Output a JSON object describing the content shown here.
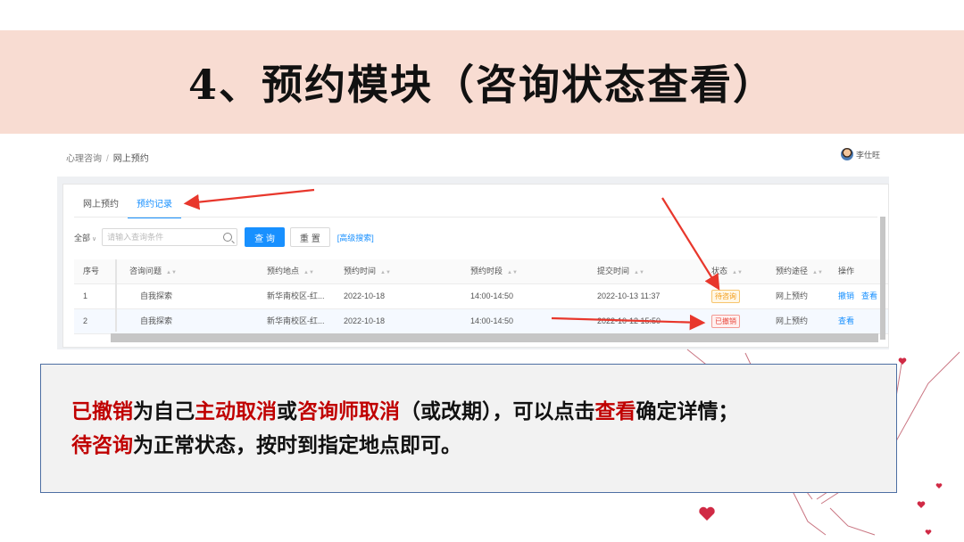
{
  "slide": {
    "title": "4、预约模块（咨询状态查看）"
  },
  "app": {
    "breadcrumb": [
      "心理咨询",
      "网上预约"
    ],
    "user_name": "李仕旺",
    "tabs": [
      {
        "label": "网上预约",
        "active": false
      },
      {
        "label": "预约记录",
        "active": true
      }
    ],
    "filter": {
      "scope": "全部",
      "search_placeholder": "请输入查询条件",
      "query_button": "查 询",
      "reset_button": "重 置",
      "advanced_link": "[高级搜索]"
    },
    "table": {
      "headers": [
        "序号",
        "咨询问题",
        "预约地点",
        "预约时间",
        "预约时段",
        "提交时间",
        "状态",
        "预约途径",
        "操作"
      ],
      "rows": [
        {
          "index": "1",
          "issue": "自我探索",
          "location": "新华南校区-红...",
          "date": "2022-10-18",
          "slot": "14:00-14:50",
          "submitted": "2022-10-13 11:37",
          "status": "待咨询",
          "status_type": "pending",
          "channel": "网上预约",
          "actions": [
            "撤销",
            "查看"
          ]
        },
        {
          "index": "2",
          "issue": "自我探索",
          "location": "新华南校区-红...",
          "date": "2022-10-18",
          "slot": "14:00-14:50",
          "submitted": "2022-10-12 15:50",
          "status": "已撤销",
          "status_type": "cancelled",
          "channel": "网上预约",
          "actions": [
            "查看"
          ]
        }
      ]
    }
  },
  "note": {
    "line1": [
      {
        "text": "已撤销",
        "red": true
      },
      {
        "text": "为自己",
        "red": false
      },
      {
        "text": "主动取消",
        "red": true
      },
      {
        "text": "或",
        "red": false
      },
      {
        "text": "咨询师取消",
        "red": true
      },
      {
        "text": "（或改期），可以点击",
        "red": false
      },
      {
        "text": "查看",
        "red": true
      },
      {
        "text": "确定详情；",
        "red": false
      }
    ],
    "line2": [
      {
        "text": "待咨询",
        "red": true
      },
      {
        "text": "为正常状态，按时到指定地点即可。",
        "red": false
      }
    ]
  },
  "colors": {
    "accent": "#1890ff",
    "title_band": "#f8dcd2",
    "emphasis_red": "#c00000",
    "arrow_red": "#e8372c"
  }
}
